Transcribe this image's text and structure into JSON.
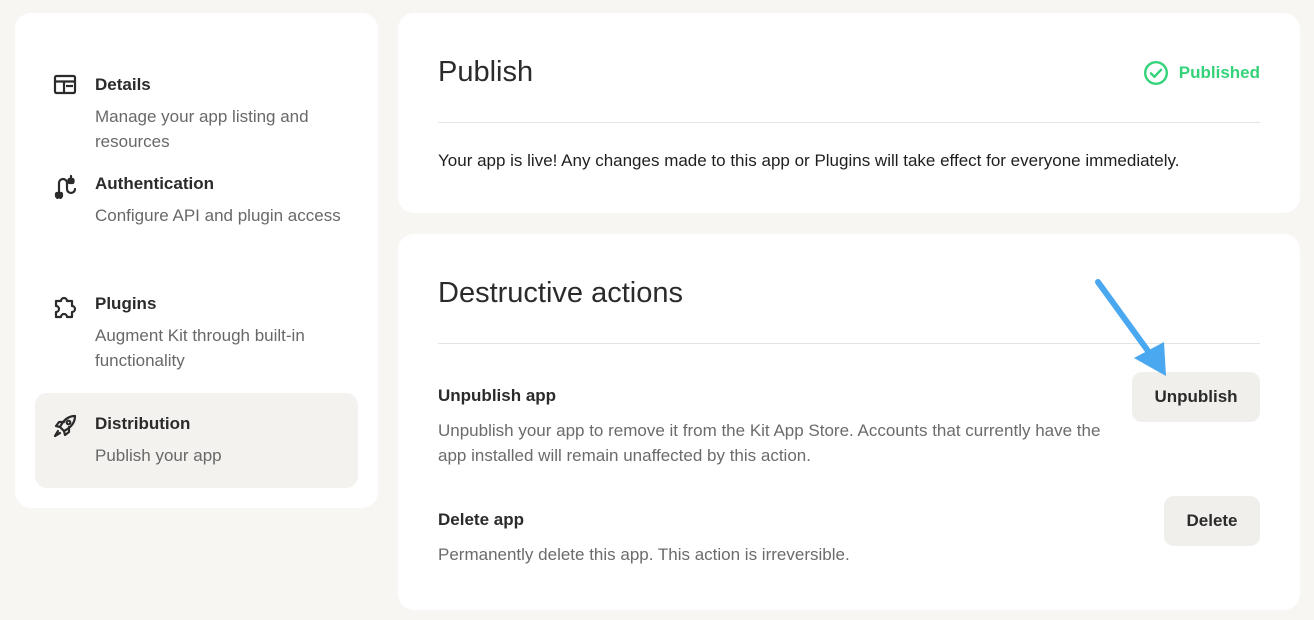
{
  "sidebar": {
    "items": [
      {
        "icon": "layout-icon",
        "title": "Details",
        "desc": "Manage your app listing and resources",
        "active": false
      },
      {
        "icon": "plug-cable-icon",
        "title": "Authentication",
        "desc": "Configure API and plugin access",
        "active": false
      },
      {
        "icon": "puzzle-icon",
        "title": "Plugins",
        "desc": "Augment Kit through built-in functionality",
        "active": false
      },
      {
        "icon": "rocket-icon",
        "title": "Distribution",
        "desc": "Publish your app",
        "active": true
      }
    ]
  },
  "publish": {
    "title": "Publish",
    "status": "Published",
    "status_color": "#34d37a",
    "message": "Your app is live! Any changes made to this app or Plugins will take effect for everyone immediately."
  },
  "destructive": {
    "title": "Destructive actions",
    "unpublish": {
      "title": "Unpublish app",
      "desc": "Unpublish your app to remove it from the Kit App Store. Accounts that currently have the app installed will remain unaffected by this action.",
      "button": "Unpublish"
    },
    "delete": {
      "title": "Delete app",
      "desc": "Permanently delete this app. This action is irreversible.",
      "button": "Delete"
    }
  },
  "annotation": {
    "arrow_color": "#4aa8f0"
  }
}
